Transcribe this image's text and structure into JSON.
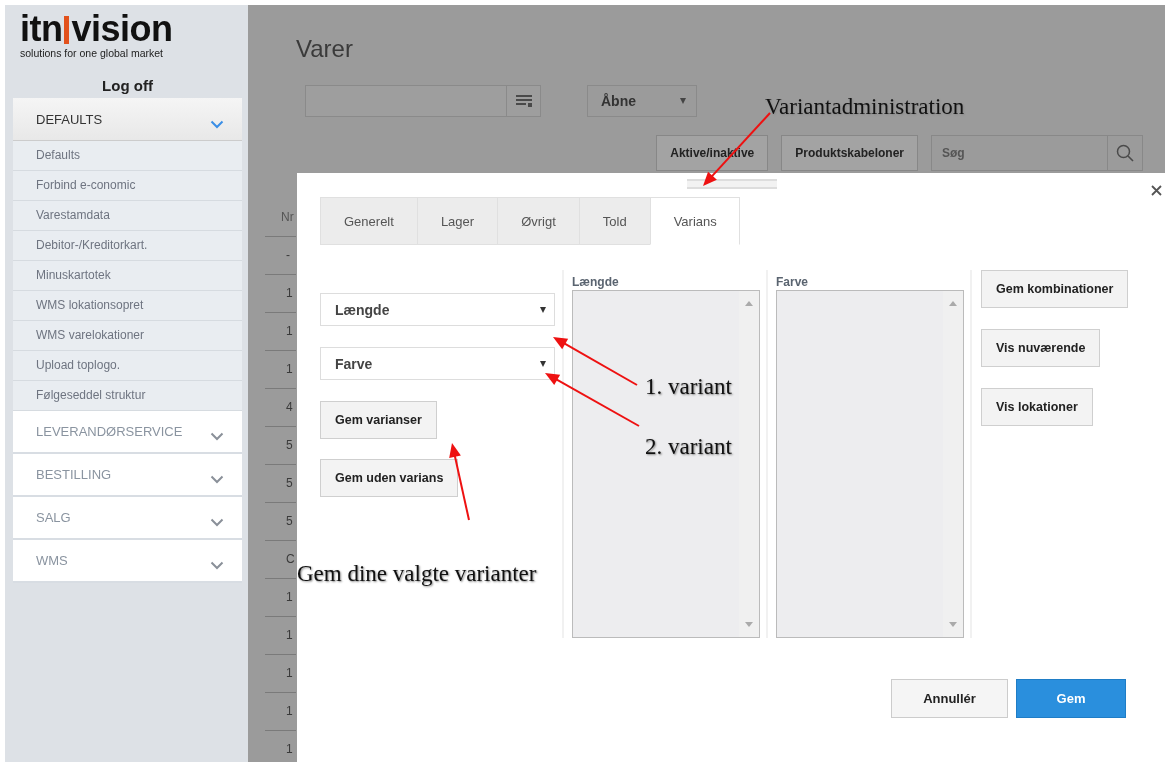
{
  "sidebar": {
    "logo": {
      "word_left": "itn",
      "word_right": "vision",
      "tagline": "solutions for one global market"
    },
    "log_off": "Log off",
    "sections": [
      {
        "label": "DEFAULTS",
        "expanded": true,
        "items": [
          "Defaults",
          "Forbind e-conomic",
          "Varestamdata",
          "Debitor-/Kreditorkart.",
          "Minuskartotek",
          "WMS lokationsopret",
          "WMS varelokationer",
          "Upload toplogo.",
          "Følgeseddel struktur"
        ]
      },
      {
        "label": "LEVERANDØRSERVICE",
        "expanded": false
      },
      {
        "label": "BESTILLING",
        "expanded": false
      },
      {
        "label": "SALG",
        "expanded": false
      },
      {
        "label": "WMS",
        "expanded": false
      }
    ]
  },
  "page": {
    "title": "Varer",
    "filter_select": "Åbne",
    "buttons": [
      "Aktive/inaktive",
      "Produktskabeloner"
    ],
    "search": {
      "placeholder": "Søg"
    },
    "table": {
      "column_1": "Nr",
      "rows": [
        "-",
        "1",
        "1",
        "1",
        "4",
        "5",
        "5",
        "5",
        "C",
        "1",
        "1",
        "1",
        "1",
        "1"
      ]
    }
  },
  "dialog": {
    "tabs": [
      {
        "label": "Generelt",
        "selected": false
      },
      {
        "label": "Lager",
        "selected": false
      },
      {
        "label": "Øvrigt",
        "selected": false
      },
      {
        "label": "Told",
        "selected": false
      },
      {
        "label": "Varians",
        "selected": true
      }
    ],
    "variant_selects": [
      "Længde",
      "Farve"
    ],
    "left_buttons": [
      "Gem varianser",
      "Gem uden varians"
    ],
    "lists": [
      "Længde",
      "Farve"
    ],
    "right_buttons": [
      "Gem kombinationer",
      "Vis nuværende",
      "Vis lokationer"
    ],
    "footer_buttons": [
      {
        "label": "Annullér",
        "kind": "secondary"
      },
      {
        "label": "Gem",
        "kind": "primary"
      }
    ]
  },
  "annotations": [
    {
      "text": "Variantadministration"
    },
    {
      "text": "1. variant"
    },
    {
      "text": "2. variant"
    },
    {
      "text": "Gem dine valgte varianter"
    }
  ]
}
